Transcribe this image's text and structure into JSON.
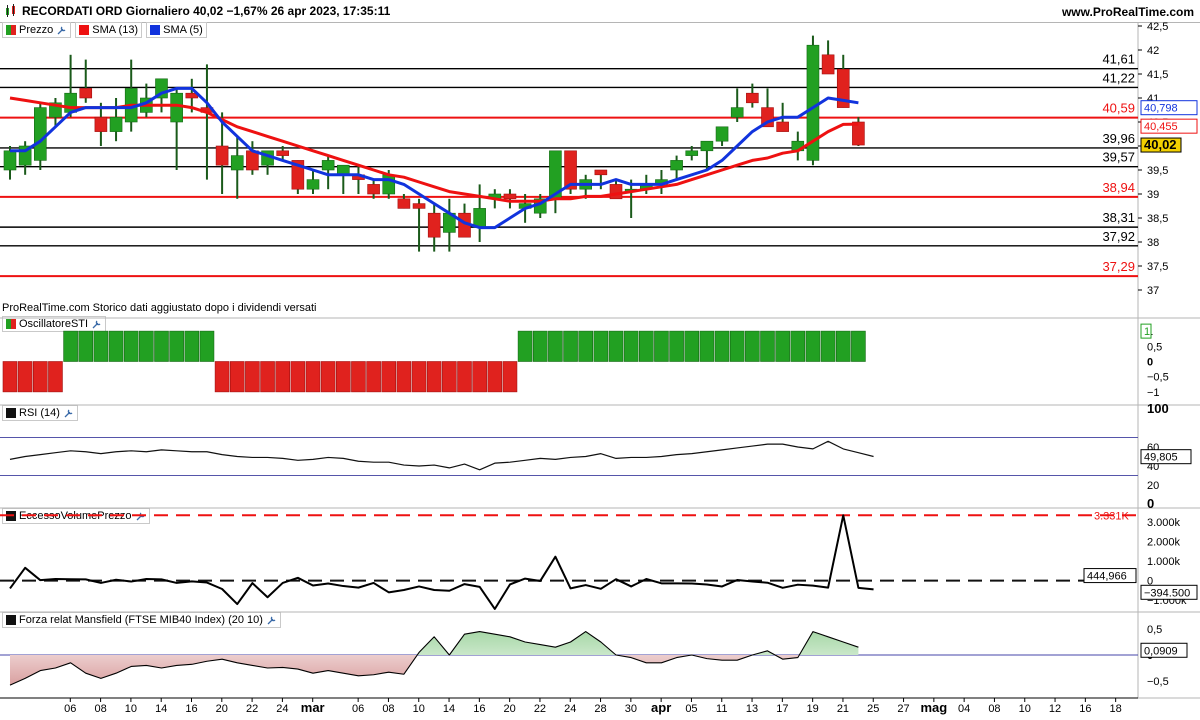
{
  "header": {
    "title": "RECORDATI ORD Giornaliero 40,02 −1,67% 26 apr 2023, 17:35:11",
    "site": "www.ProRealTime.com"
  },
  "legend": {
    "price": "Prezzo",
    "sma13": "SMA (13)",
    "sma5": "SMA (5)",
    "colors": {
      "up": "#22a022",
      "down": "#e0221e",
      "sma13": "#ee1111",
      "sma5": "#1133dd"
    }
  },
  "footer_note": "ProRealTime.com Storico dati aggiustato dopo i dividendi versati",
  "panels": {
    "osc": "OscillatoreSTI",
    "rsi": "RSI (14)",
    "evp": "EccessoVolumePrezzo",
    "mansfield": "Forza relat Mansfield (FTSE MIB40 Index) (20 10)"
  },
  "chart_data": [
    {
      "type": "candlestick",
      "title": "RECORDATI ORD Giornaliero",
      "ylim": [
        36.5,
        42.5
      ],
      "yticks": [
        "42,5",
        "42",
        "41,5",
        "41",
        "40,5",
        "40",
        "39,5",
        "39",
        "38,5",
        "38",
        "37,5",
        "37"
      ],
      "candles": [
        {
          "o": 39.5,
          "h": 40.0,
          "l": 39.3,
          "c": 39.9
        },
        {
          "o": 39.6,
          "h": 40.1,
          "l": 39.4,
          "c": 40.0
        },
        {
          "o": 39.7,
          "h": 40.9,
          "l": 39.5,
          "c": 40.8
        },
        {
          "o": 40.6,
          "h": 41.0,
          "l": 40.4,
          "c": 40.9
        },
        {
          "o": 40.7,
          "h": 41.9,
          "l": 40.6,
          "c": 41.1
        },
        {
          "o": 41.2,
          "h": 41.8,
          "l": 40.9,
          "c": 41.0
        },
        {
          "o": 40.6,
          "h": 40.9,
          "l": 40.0,
          "c": 40.3
        },
        {
          "o": 40.3,
          "h": 41.0,
          "l": 40.1,
          "c": 40.6
        },
        {
          "o": 40.5,
          "h": 41.8,
          "l": 40.3,
          "c": 41.2
        },
        {
          "o": 40.7,
          "h": 41.3,
          "l": 40.6,
          "c": 41.0
        },
        {
          "o": 41.0,
          "h": 41.4,
          "l": 40.7,
          "c": 41.4
        },
        {
          "o": 40.5,
          "h": 41.2,
          "l": 39.5,
          "c": 41.1
        },
        {
          "o": 41.1,
          "h": 41.4,
          "l": 40.7,
          "c": 41.0
        },
        {
          "o": 40.8,
          "h": 41.7,
          "l": 39.3,
          "c": 40.7
        },
        {
          "o": 40.0,
          "h": 40.7,
          "l": 39.0,
          "c": 39.6
        },
        {
          "o": 39.5,
          "h": 40.2,
          "l": 38.9,
          "c": 39.8
        },
        {
          "o": 39.9,
          "h": 40.1,
          "l": 39.4,
          "c": 39.5
        },
        {
          "o": 39.6,
          "h": 39.9,
          "l": 39.4,
          "c": 39.9
        },
        {
          "o": 39.9,
          "h": 40.0,
          "l": 39.7,
          "c": 39.8
        },
        {
          "o": 39.7,
          "h": 39.7,
          "l": 39.0,
          "c": 39.1
        },
        {
          "o": 39.1,
          "h": 39.5,
          "l": 39.0,
          "c": 39.3
        },
        {
          "o": 39.5,
          "h": 39.8,
          "l": 39.1,
          "c": 39.7
        },
        {
          "o": 39.4,
          "h": 39.6,
          "l": 39.0,
          "c": 39.6
        },
        {
          "o": 39.4,
          "h": 39.6,
          "l": 39.0,
          "c": 39.3
        },
        {
          "o": 39.2,
          "h": 39.3,
          "l": 38.9,
          "c": 39.0
        },
        {
          "o": 39.0,
          "h": 39.5,
          "l": 38.9,
          "c": 39.4
        },
        {
          "o": 38.9,
          "h": 39.0,
          "l": 38.7,
          "c": 38.7
        },
        {
          "o": 38.8,
          "h": 38.9,
          "l": 37.8,
          "c": 38.7
        },
        {
          "o": 38.6,
          "h": 38.8,
          "l": 37.8,
          "c": 38.1
        },
        {
          "o": 38.2,
          "h": 38.9,
          "l": 37.8,
          "c": 38.6
        },
        {
          "o": 38.6,
          "h": 38.8,
          "l": 38.1,
          "c": 38.1
        },
        {
          "o": 38.3,
          "h": 39.2,
          "l": 38.0,
          "c": 38.7
        },
        {
          "o": 38.9,
          "h": 39.1,
          "l": 38.7,
          "c": 39.0
        },
        {
          "o": 39.0,
          "h": 39.1,
          "l": 38.7,
          "c": 38.9
        },
        {
          "o": 38.7,
          "h": 39.0,
          "l": 38.4,
          "c": 38.8
        },
        {
          "o": 38.6,
          "h": 39.0,
          "l": 38.5,
          "c": 38.9
        },
        {
          "o": 38.9,
          "h": 39.9,
          "l": 38.6,
          "c": 39.9
        },
        {
          "o": 39.9,
          "h": 39.9,
          "l": 39.0,
          "c": 39.1
        },
        {
          "o": 39.1,
          "h": 39.4,
          "l": 38.9,
          "c": 39.3
        },
        {
          "o": 39.5,
          "h": 39.5,
          "l": 39.1,
          "c": 39.4
        },
        {
          "o": 39.2,
          "h": 39.3,
          "l": 38.9,
          "c": 38.9
        },
        {
          "o": 39.1,
          "h": 39.3,
          "l": 38.5,
          "c": 39.1
        },
        {
          "o": 39.1,
          "h": 39.4,
          "l": 39.0,
          "c": 39.2
        },
        {
          "o": 39.2,
          "h": 39.5,
          "l": 39.0,
          "c": 39.3
        },
        {
          "o": 39.5,
          "h": 39.8,
          "l": 39.3,
          "c": 39.7
        },
        {
          "o": 39.8,
          "h": 40.0,
          "l": 39.7,
          "c": 39.9
        },
        {
          "o": 39.9,
          "h": 40.1,
          "l": 39.5,
          "c": 40.1
        },
        {
          "o": 40.1,
          "h": 40.4,
          "l": 40.0,
          "c": 40.4
        },
        {
          "o": 40.6,
          "h": 41.2,
          "l": 40.5,
          "c": 40.8
        },
        {
          "o": 41.1,
          "h": 41.3,
          "l": 40.8,
          "c": 40.9
        },
        {
          "o": 40.8,
          "h": 41.2,
          "l": 40.5,
          "c": 40.4
        },
        {
          "o": 40.5,
          "h": 40.9,
          "l": 40.3,
          "c": 40.3
        },
        {
          "o": 39.9,
          "h": 40.3,
          "l": 39.7,
          "c": 40.1
        },
        {
          "o": 39.7,
          "h": 42.3,
          "l": 39.6,
          "c": 42.1
        },
        {
          "o": 41.9,
          "h": 42.2,
          "l": 41.5,
          "c": 41.5
        },
        {
          "o": 41.6,
          "h": 41.9,
          "l": 40.8,
          "c": 40.8
        },
        {
          "o": 40.5,
          "h": 40.6,
          "l": 40.0,
          "c": 40.02
        }
      ],
      "sma5": [
        39.9,
        39.9,
        40.1,
        40.4,
        40.7,
        40.8,
        40.8,
        40.8,
        40.8,
        40.9,
        41.1,
        41.2,
        41.2,
        40.9,
        40.5,
        40.2,
        39.9,
        39.8,
        39.7,
        39.6,
        39.5,
        39.4,
        39.4,
        39.4,
        39.3,
        39.3,
        39.2,
        39.0,
        38.8,
        38.6,
        38.4,
        38.3,
        38.3,
        38.5,
        38.7,
        38.8,
        39.0,
        39.2,
        39.2,
        39.2,
        39.3,
        39.2,
        39.2,
        39.2,
        39.3,
        39.4,
        39.5,
        39.7,
        40.0,
        40.3,
        40.5,
        40.6,
        40.6,
        40.8,
        41.0,
        40.95,
        40.9
      ],
      "sma13": [
        41.0,
        40.95,
        40.9,
        40.85,
        40.8,
        40.8,
        40.8,
        40.8,
        40.85,
        40.85,
        40.85,
        40.85,
        40.8,
        40.7,
        40.55,
        40.4,
        40.3,
        40.2,
        40.1,
        40.0,
        39.9,
        39.8,
        39.7,
        39.6,
        39.5,
        39.4,
        39.35,
        39.25,
        39.15,
        39.05,
        39.0,
        38.95,
        38.9,
        38.85,
        38.85,
        38.85,
        38.9,
        38.9,
        38.95,
        38.95,
        39.0,
        39.05,
        39.1,
        39.15,
        39.2,
        39.3,
        39.4,
        39.5,
        39.6,
        39.7,
        39.75,
        39.85,
        39.9,
        40.1,
        40.3,
        40.45,
        40.455
      ],
      "levels": [
        {
          "value": 41.61,
          "label": "41,61",
          "color": "#000000"
        },
        {
          "value": 41.22,
          "label": "41,22",
          "color": "#000000"
        },
        {
          "value": 40.59,
          "label": "40,59",
          "color": "#ee1111"
        },
        {
          "value": 39.96,
          "label": "39,96",
          "color": "#000000"
        },
        {
          "value": 39.57,
          "label": "39,57",
          "color": "#000000"
        },
        {
          "value": 38.94,
          "label": "38,94",
          "color": "#ee1111"
        },
        {
          "value": 38.31,
          "label": "38,31",
          "color": "#000000"
        },
        {
          "value": 37.92,
          "label": "37,92",
          "color": "#000000"
        },
        {
          "value": 37.29,
          "label": "37,29",
          "color": "#ee1111"
        }
      ],
      "price_tags": {
        "sma5": "40,798",
        "sma13": "40,455",
        "last": "40,02"
      }
    },
    {
      "type": "bar",
      "title": "OscillatoreSTI",
      "ylim": [
        -1.3,
        1.3
      ],
      "yticks": [
        "1",
        "0,5",
        "0",
        "−0,5",
        "−1"
      ],
      "values": [
        -1,
        -1,
        -1,
        -1,
        1,
        1,
        1,
        1,
        1,
        1,
        1,
        1,
        1,
        1,
        -1,
        -1,
        -1,
        -1,
        -1,
        -1,
        -1,
        -1,
        -1,
        -1,
        -1,
        -1,
        -1,
        -1,
        -1,
        -1,
        -1,
        -1,
        -1,
        -1,
        1,
        1,
        1,
        1,
        1,
        1,
        1,
        1,
        1,
        1,
        1,
        1,
        1,
        1,
        1,
        1,
        1,
        1,
        1,
        1,
        1,
        1,
        1
      ],
      "last_tag": "1"
    },
    {
      "type": "line",
      "title": "RSI (14)",
      "ylim": [
        0,
        100
      ],
      "yticks": [
        "100",
        "60",
        "40",
        "20",
        "0"
      ],
      "levels": [
        70,
        30
      ],
      "values": [
        47,
        50,
        52,
        54,
        56,
        55,
        53,
        55,
        56,
        55,
        57,
        56,
        55,
        55,
        52,
        50,
        49,
        49,
        48,
        46,
        47,
        49,
        48,
        45,
        44,
        44,
        41,
        40,
        41,
        38,
        42,
        36,
        43,
        44,
        46,
        48,
        47,
        49,
        50,
        53,
        48,
        49,
        49,
        50,
        52,
        53,
        55,
        57,
        59,
        61,
        63,
        63,
        60,
        58,
        66,
        58,
        54,
        50
      ],
      "last_tag": "49,805"
    },
    {
      "type": "line",
      "title": "EccessoVolumePrezzo",
      "ylim": [
        -1400,
        3500
      ],
      "yticks": [
        "3.000k",
        "2.000k",
        "1.000k",
        "0",
        "−1.000k"
      ],
      "max_label": "3.331K",
      "max_value": 3331,
      "baseline_value": 0,
      "values": [
        -400,
        650,
        20,
        80,
        70,
        60,
        -120,
        40,
        -50,
        80,
        60,
        -120,
        -40,
        -100,
        -430,
        -1200,
        -130,
        -850,
        -120,
        140,
        -250,
        -150,
        -280,
        -360,
        -120,
        -600,
        -480,
        -300,
        -480,
        -520,
        -180,
        -320,
        -1450,
        -200,
        100,
        -20,
        1220,
        -400,
        -230,
        -420,
        70,
        -300,
        80,
        -140,
        -140,
        -150,
        -200,
        -300,
        30,
        -50,
        -110,
        -370,
        -210,
        -260,
        -360,
        3331,
        -370,
        -450
      ],
      "last_tags": {
        "level": "444,966",
        "last": "−394.500"
      }
    },
    {
      "type": "area",
      "title": "Forza relat Mansfield (FTSE MIB40 Index) (20 10)",
      "ylim": [
        -0.75,
        0.75
      ],
      "yticks": [
        "0,5",
        "0",
        "−0,5"
      ],
      "values": [
        -0.58,
        -0.45,
        -0.3,
        -0.25,
        -0.15,
        -0.35,
        -0.45,
        -0.35,
        -0.22,
        -0.2,
        -0.25,
        -0.2,
        -0.18,
        -0.12,
        -0.08,
        -0.15,
        -0.2,
        -0.25,
        -0.24,
        -0.27,
        -0.35,
        -0.3,
        -0.35,
        -0.4,
        -0.38,
        -0.33,
        -0.37,
        0.05,
        0.35,
        0.0,
        0.4,
        0.45,
        0.4,
        0.35,
        0.25,
        0.2,
        0.15,
        0.25,
        0.45,
        0.25,
        0.0,
        -0.05,
        -0.15,
        -0.15,
        -0.05,
        0.0,
        -0.07,
        -0.1,
        -0.1,
        0.0,
        0.08,
        -0.08,
        -0.05,
        0.45,
        0.35,
        0.25,
        0.15
      ],
      "last_tag": "0,0909"
    }
  ],
  "xaxis": {
    "labels": [
      {
        "i": 2,
        "t": "06"
      },
      {
        "i": 4,
        "t": "08"
      },
      {
        "i": 6,
        "t": "10"
      },
      {
        "i": 8,
        "t": "14"
      },
      {
        "i": 10,
        "t": "16"
      },
      {
        "i": 12,
        "t": "20"
      },
      {
        "i": 14,
        "t": "22"
      },
      {
        "i": 16,
        "t": "24"
      },
      {
        "i": 18,
        "t": "mar"
      },
      {
        "i": 21,
        "t": "06"
      },
      {
        "i": 23,
        "t": "08"
      },
      {
        "i": 25,
        "t": "10"
      },
      {
        "i": 27,
        "t": "14"
      },
      {
        "i": 29,
        "t": "16"
      },
      {
        "i": 31,
        "t": "20"
      },
      {
        "i": 33,
        "t": "22"
      },
      {
        "i": 35,
        "t": "24"
      },
      {
        "i": 37,
        "t": "28"
      },
      {
        "i": 39,
        "t": "30"
      },
      {
        "i": 41,
        "t": "apr"
      },
      {
        "i": 43,
        "t": "05"
      },
      {
        "i": 45,
        "t": "11"
      },
      {
        "i": 47,
        "t": "13"
      },
      {
        "i": 49,
        "t": "17"
      },
      {
        "i": 51,
        "t": "19"
      },
      {
        "i": 53,
        "t": "21"
      },
      {
        "i": 55,
        "t": "25"
      },
      {
        "i": 57,
        "t": "27"
      },
      {
        "i": 59,
        "t": "mag"
      },
      {
        "i": 61,
        "t": "04"
      },
      {
        "i": 63,
        "t": "08"
      },
      {
        "i": 65,
        "t": "10"
      },
      {
        "i": 67,
        "t": "12"
      },
      {
        "i": 69,
        "t": "16"
      },
      {
        "i": 71,
        "t": "18"
      }
    ]
  }
}
